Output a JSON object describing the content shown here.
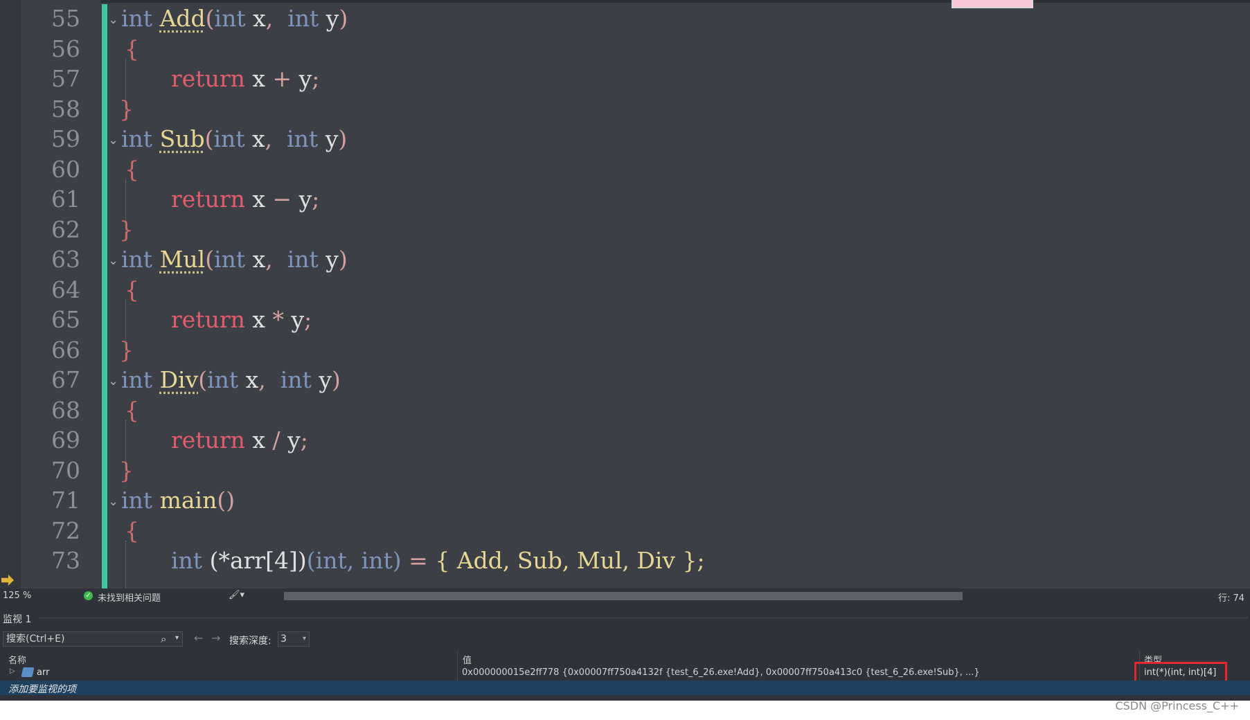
{
  "editor": {
    "lines": [
      {
        "n": "55",
        "kind": "sig",
        "fn": "Add"
      },
      {
        "n": "56",
        "kind": "open"
      },
      {
        "n": "57",
        "kind": "ret",
        "op": "+"
      },
      {
        "n": "58",
        "kind": "close"
      },
      {
        "n": "59",
        "kind": "sig",
        "fn": "Sub"
      },
      {
        "n": "60",
        "kind": "open"
      },
      {
        "n": "61",
        "kind": "ret",
        "op": "−"
      },
      {
        "n": "62",
        "kind": "close"
      },
      {
        "n": "63",
        "kind": "sig",
        "fn": "Mul"
      },
      {
        "n": "64",
        "kind": "open"
      },
      {
        "n": "65",
        "kind": "ret",
        "op": "*"
      },
      {
        "n": "66",
        "kind": "close"
      },
      {
        "n": "67",
        "kind": "sig",
        "fn": "Div"
      },
      {
        "n": "68",
        "kind": "open"
      },
      {
        "n": "69",
        "kind": "ret",
        "op": "/"
      },
      {
        "n": "70",
        "kind": "close"
      },
      {
        "n": "71",
        "kind": "main"
      },
      {
        "n": "72",
        "kind": "open"
      },
      {
        "n": "73",
        "kind": "arr"
      }
    ],
    "tokens": {
      "int": "int",
      "return": "return",
      "x": "x",
      "y": "y",
      "main": "main",
      "arr_decl": "(*arr[4])",
      "arr_params": "(int, int)",
      "arr_init": "{ Add, Sub, Mul, Div };"
    }
  },
  "status": {
    "zoom": "125 %",
    "issues": "未找到相关问题",
    "row": "行: 74"
  },
  "watch": {
    "title": "监视 1",
    "search_placeholder": "搜索(Ctrl+E)",
    "depth_label": "搜索深度:",
    "depth_value": "3",
    "col_name": "名称",
    "col_value": "值",
    "col_type": "类型",
    "rows": [
      {
        "name": "arr",
        "value": "0x000000015e2ff778 {0x00007ff750a4132f {test_6_26.exe!Add}, 0x00007ff750a413c0 {test_6_26.exe!Sub}, ...}",
        "type": "int(*)(int, int)[4]"
      }
    ],
    "add_item": "添加要监视的项"
  },
  "watermark": "CSDN @Princess_C++",
  "colors": {
    "editor_bg": "#3c3f46",
    "change_bar": "#3fc7a1",
    "keyword": "#7e94b8",
    "function": "#e8d792",
    "return": "#e35c6c",
    "highlight_box": "#e5262c"
  }
}
